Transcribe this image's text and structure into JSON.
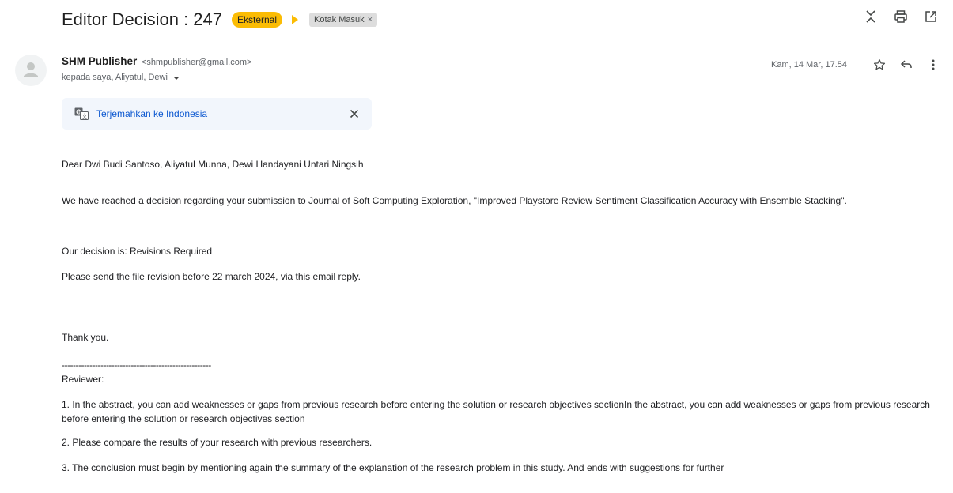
{
  "header": {
    "subject": "Editor Decision : 247",
    "label_external": "Eksternal",
    "label_inbox": "Kotak Masuk",
    "label_inbox_close": "×",
    "colors": {
      "external_label": "#fbbc04",
      "inbox_label": "#dddddd",
      "link": "#0b57d0"
    },
    "icons": [
      "collapse-all-icon",
      "print-icon",
      "open-in-new-window-icon"
    ]
  },
  "message": {
    "sender_name": "SHM Publisher",
    "sender_email": "<shmpublisher@gmail.com>",
    "recipients": "kepada saya, Aliyatul, Dewi",
    "date": "Kam, 14 Mar, 17.54",
    "icons": [
      "star-icon",
      "reply-icon",
      "more-options-icon"
    ]
  },
  "translate": {
    "link": "Terjemahkan ke Indonesia",
    "close": "×"
  },
  "body": {
    "greeting": "Dear Dwi Budi Santoso, Aliyatul Munna, Dewi Handayani Untari Ningsih",
    "p_decision_reached": "We have reached a decision regarding your submission to Journal of Soft Computing Exploration, \"Improved Playstore Review Sentiment Classification Accuracy with Ensemble Stacking\".",
    "p_decision": "Our decision is: Revisions Required",
    "p_deadline": "Please send the file revision before 22 march 2024, via this email reply.",
    "p_thanks": "Thank you.",
    "divider": "------------------------------------------------------",
    "reviewer_heading": "Reviewer:",
    "item1": "1. In the abstract, you can add weaknesses or gaps from previous research before entering the solution or research objectives sectionIn the abstract, you can add weaknesses or gaps from previous research before entering the solution or research objectives section",
    "item2": "2. Please  compare the results of your research with previous researchers.",
    "item3": "3. The conclusion must begin by mentioning again the summary of the explanation of the research problem in this study. And ends with suggestions for further"
  }
}
